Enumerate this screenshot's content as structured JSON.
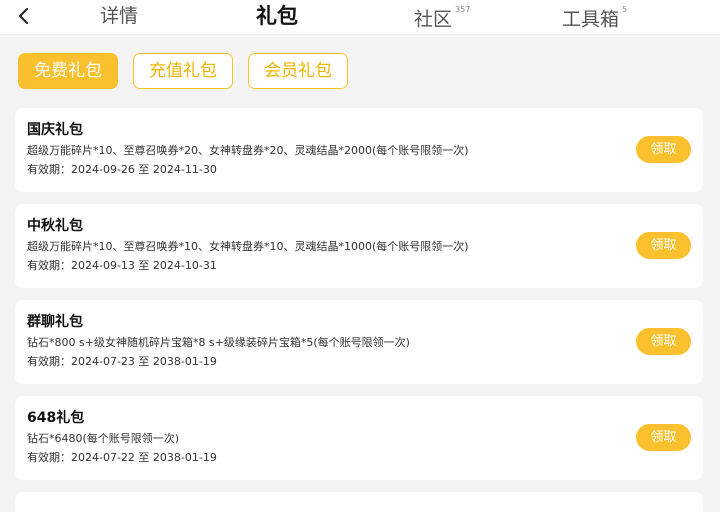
{
  "header": {
    "tabs": [
      {
        "label": "详情",
        "count": ""
      },
      {
        "label": "礼包",
        "count": ""
      },
      {
        "label": "社区",
        "count": "357"
      },
      {
        "label": "工具箱",
        "count": "5"
      }
    ],
    "active_tab": 1
  },
  "filters": [
    {
      "label": "免费礼包",
      "active": true
    },
    {
      "label": "充值礼包",
      "active": false
    },
    {
      "label": "会员礼包",
      "active": false
    }
  ],
  "gifts": [
    {
      "name": "国庆礼包",
      "desc": "超级万能碎片*10、至尊召唤券*20、女神转盘券*20、灵魂结晶*2000(每个账号限领一次)",
      "validity": "有效期：2024-09-26 至 2024-11-30",
      "button": "领取"
    },
    {
      "name": "中秋礼包",
      "desc": "超级万能碎片*10、至尊召唤券*10、女神转盘券*10、灵魂结晶*1000(每个账号限领一次)",
      "validity": "有效期：2024-09-13 至 2024-10-31",
      "button": "领取"
    },
    {
      "name": "群聊礼包",
      "desc": "钻石*800 s+级女神随机碎片宝箱*8 s+级缘装碎片宝箱*5(每个账号限领一次)",
      "validity": "有效期：2024-07-23 至 2038-01-19",
      "button": "领取"
    },
    {
      "name": "648礼包",
      "desc": "钻石*6480(每个账号限领一次)",
      "validity": "有效期：2024-07-22 至 2038-01-19",
      "button": "领取"
    }
  ],
  "colors": {
    "accent": "#fbc02d",
    "background": "#f4f4f4",
    "card": "#ffffff"
  },
  "icons": {
    "back": "chevron-left-icon"
  }
}
